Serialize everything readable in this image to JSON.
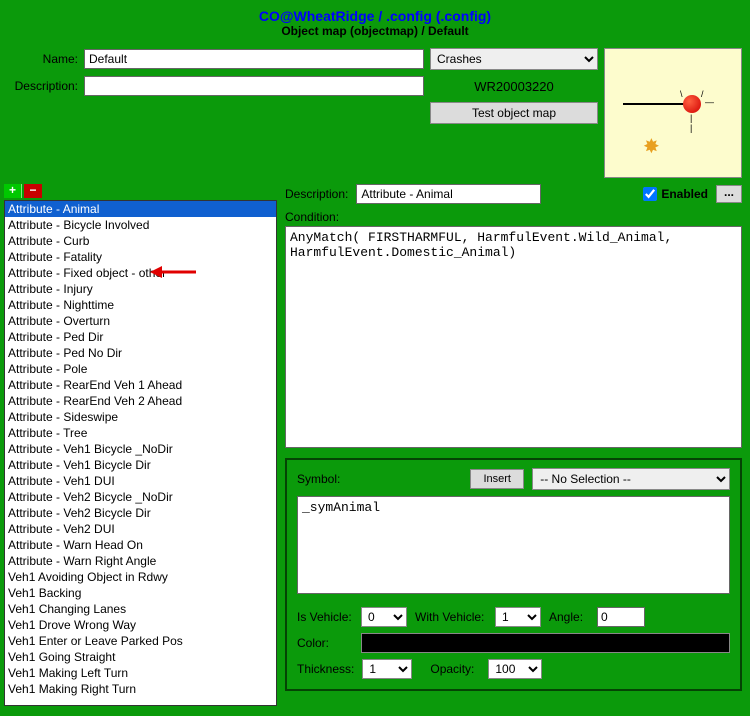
{
  "header": {
    "title": "CO@WheatRidge / .config (.config)",
    "subtitle": "Object map (objectmap) / Default"
  },
  "form": {
    "name_label": "Name:",
    "name_value": "Default",
    "crashes_value": "Crashes",
    "desc_label": "Description:",
    "desc_value": "",
    "wr_label": "WR20003220",
    "test_btn": "Test object map"
  },
  "attrs": [
    "Attribute - Animal",
    "Attribute - Bicycle Involved",
    "Attribute - Curb",
    "Attribute - Fatality",
    "Attribute - Fixed object - other",
    "Attribute - Injury",
    "Attribute - Nighttime",
    "Attribute - Overturn",
    "Attribute - Ped Dir",
    "Attribute - Ped No Dir",
    "Attribute - Pole",
    "Attribute - RearEnd Veh 1 Ahead",
    "Attribute - RearEnd Veh 2 Ahead",
    "Attribute - Sideswipe",
    "Attribute - Tree",
    "Attribute - Veh1 Bicycle _NoDir",
    "Attribute - Veh1 Bicycle Dir",
    "Attribute - Veh1 DUI",
    "Attribute - Veh2 Bicycle _NoDir",
    "Attribute - Veh2 Bicycle Dir",
    "Attribute - Veh2 DUI",
    "Attribute - Warn Head On",
    "Attribute - Warn Right Angle",
    "Veh1 Avoiding Object in Rdwy",
    "Veh1 Backing",
    "Veh1 Changing Lanes",
    "Veh1 Drove Wrong Way",
    "Veh1 Enter or Leave Parked Pos",
    "Veh1 Going Straight",
    "Veh1 Making Left Turn",
    "Veh1 Making Right Turn"
  ],
  "selected_index": 0,
  "right": {
    "desc_label": "Description:",
    "desc_value": "Attribute - Animal",
    "enabled_label": "Enabled",
    "dots": "...",
    "condition_label": "Condition:",
    "condition_value": "AnyMatch( FIRSTHARMFUL, HarmfulEvent.Wild_Animal, HarmfulEvent.Domestic_Animal)"
  },
  "symbol": {
    "label": "Symbol:",
    "insert_btn": "Insert",
    "select_value": "-- No Selection --",
    "box_value": "_symAnimal",
    "isvehicle_label": "Is Vehicle:",
    "isvehicle_value": "0",
    "withvehicle_label": "With Vehicle:",
    "withvehicle_value": "1",
    "angle_label": "Angle:",
    "angle_value": "0",
    "color_label": "Color:",
    "thickness_label": "Thickness:",
    "thickness_value": "1",
    "opacity_label": "Opacity:",
    "opacity_value": "100"
  }
}
